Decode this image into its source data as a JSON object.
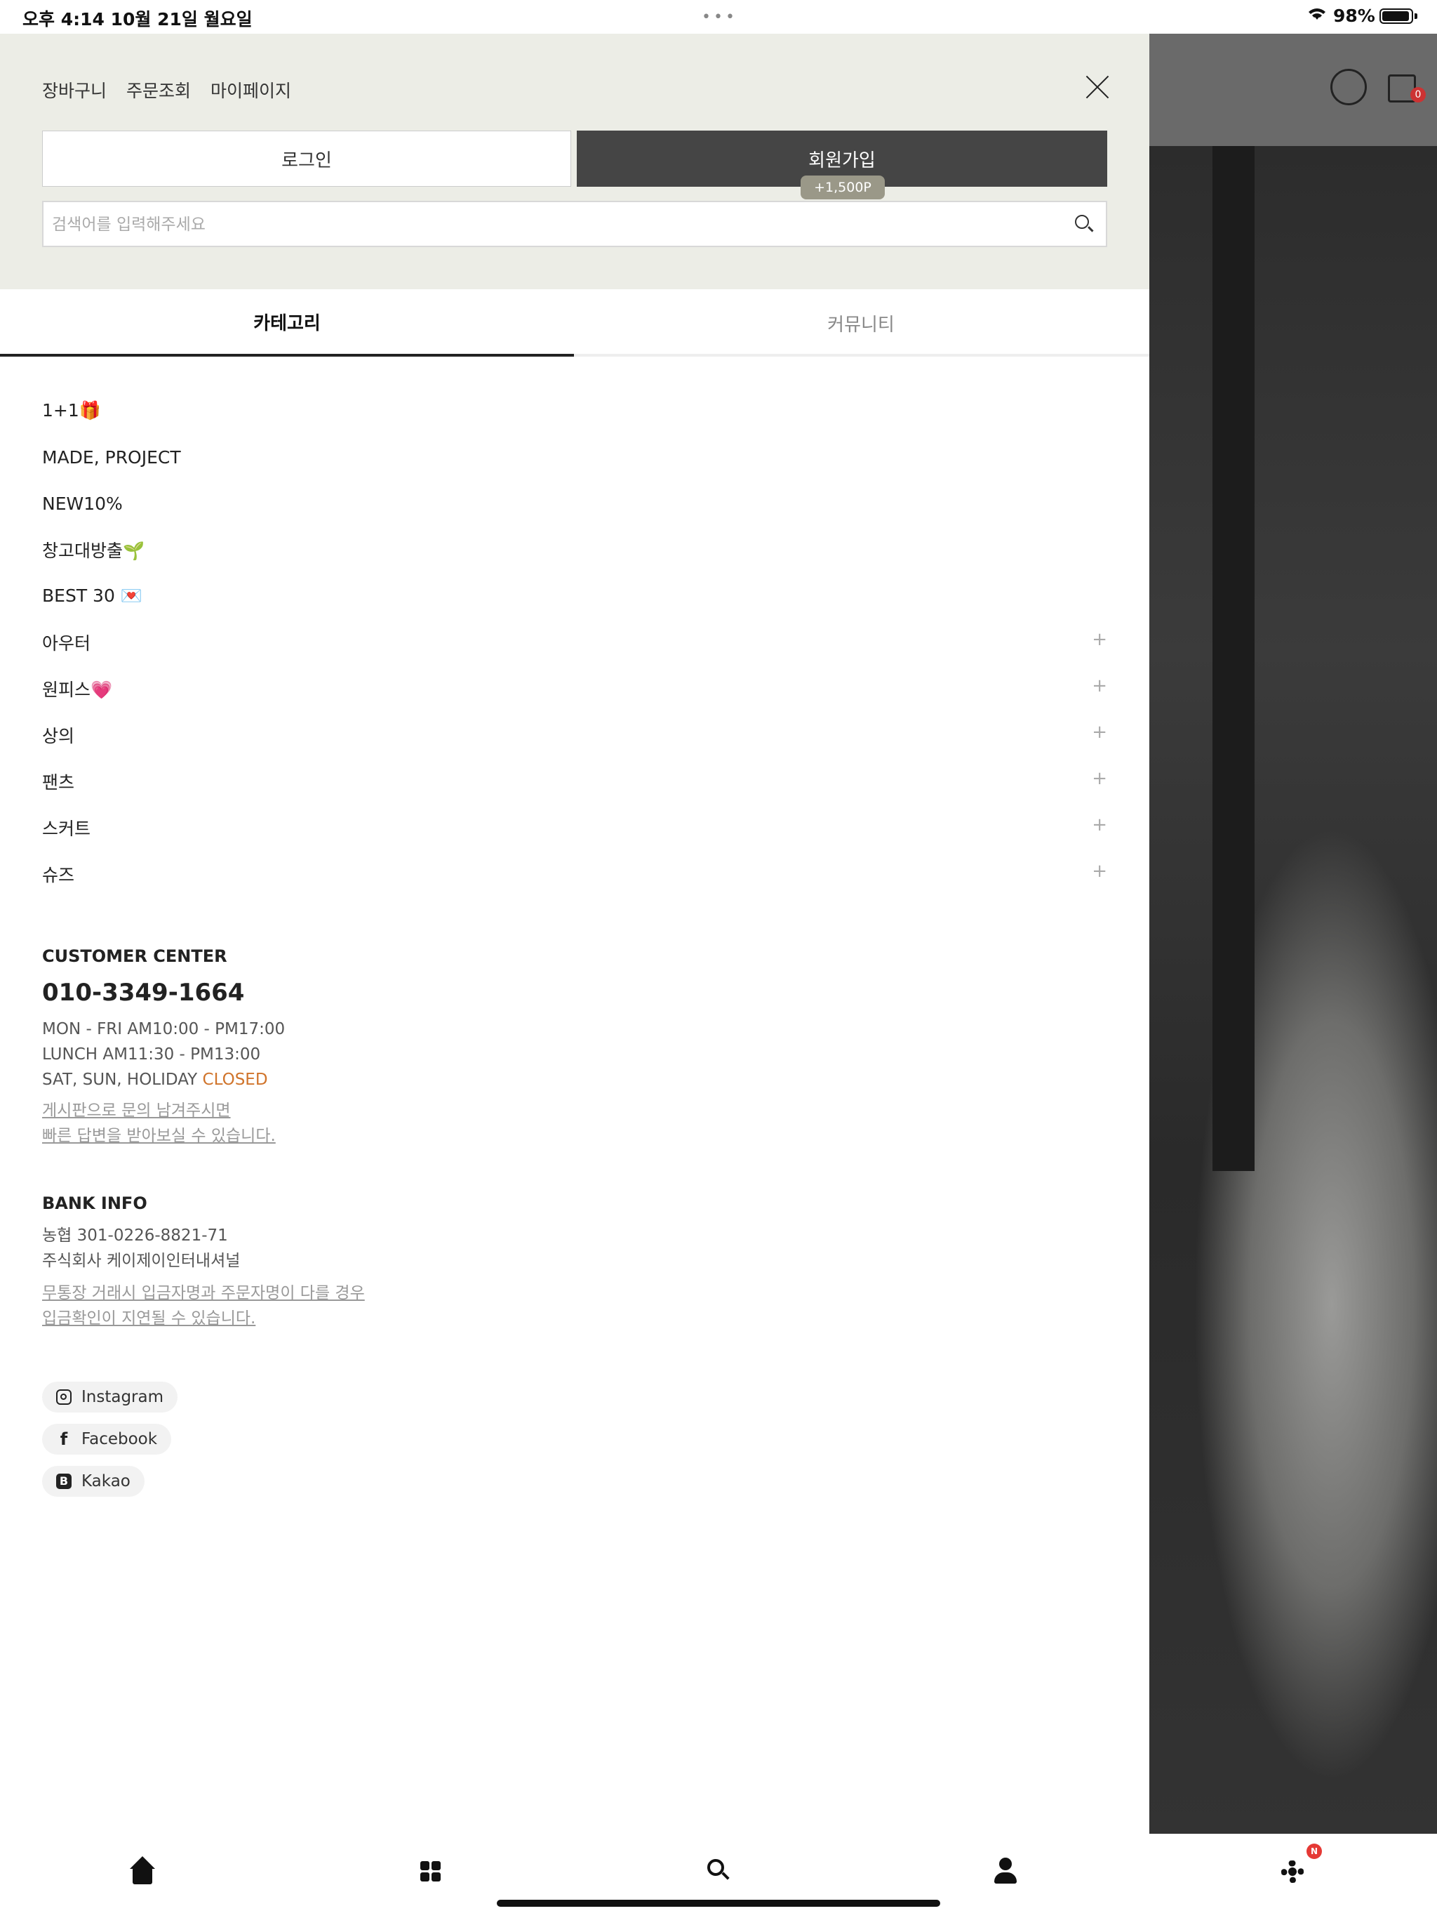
{
  "status_bar": {
    "time": "오후 4:14   10월 21일 월요일",
    "dots": "•••",
    "battery": "98%"
  },
  "header_right": {
    "cart_count": "0"
  },
  "drawer": {
    "top_links": [
      "장바구니",
      "주문조회",
      "마이페이지"
    ],
    "login_label": "로그인",
    "join_label": "회원가입",
    "join_badge": "+1,500P",
    "search_placeholder": "검색어를 입력해주세요"
  },
  "tabs": {
    "category": "카테고리",
    "community": "커뮤니티"
  },
  "categories": [
    {
      "label": "1+1🎁",
      "expandable": false
    },
    {
      "label": "MADE, PROJECT",
      "expandable": false
    },
    {
      "label": "NEW10%",
      "expandable": false
    },
    {
      "label": "창고대방출🌱",
      "expandable": false
    },
    {
      "label": "BEST 30 💌",
      "expandable": false
    },
    {
      "label": "아우터",
      "expandable": true
    },
    {
      "label": "원피스💗",
      "expandable": true
    },
    {
      "label": "상의",
      "expandable": true
    },
    {
      "label": "팬츠",
      "expandable": true
    },
    {
      "label": "스커트",
      "expandable": true
    },
    {
      "label": "슈즈",
      "expandable": true
    }
  ],
  "plus_symbol": "+",
  "customer_center": {
    "title": "CUSTOMER CENTER",
    "phone": "010-3349-1664",
    "hours_weekday": "MON - FRI AM10:00 - PM17:00",
    "lunch": "LUNCH AM11:30 - PM13:00",
    "weekend_prefix": "SAT, SUN, HOLIDAY ",
    "weekend_status": "CLOSED",
    "link_line1": "게시판으로 문의 남겨주시면",
    "link_line2": "빠른 답변을 받아보실 수 있습니다."
  },
  "bank_info": {
    "title": "BANK INFO",
    "account": "농협 301-0226-8821-71",
    "holder": "주식회사 케이제이인터내셔널",
    "note_line1": "무통장 거래시 입금자명과 주문자명이 다를 경우",
    "note_line2": "입금확인이 지연될 수 있습니다."
  },
  "social": [
    {
      "label": "Instagram",
      "icon": "instagram-icon"
    },
    {
      "label": "Facebook",
      "icon": "facebook-icon"
    },
    {
      "label": "Kakao",
      "icon": "kakao-icon"
    }
  ],
  "tabbar": {
    "badge": "N"
  },
  "colors": {
    "drawer_top_bg": "#ecede6",
    "join_button_bg": "#454545",
    "closed_accent": "#d0742b",
    "badge_red": "#e53935"
  }
}
